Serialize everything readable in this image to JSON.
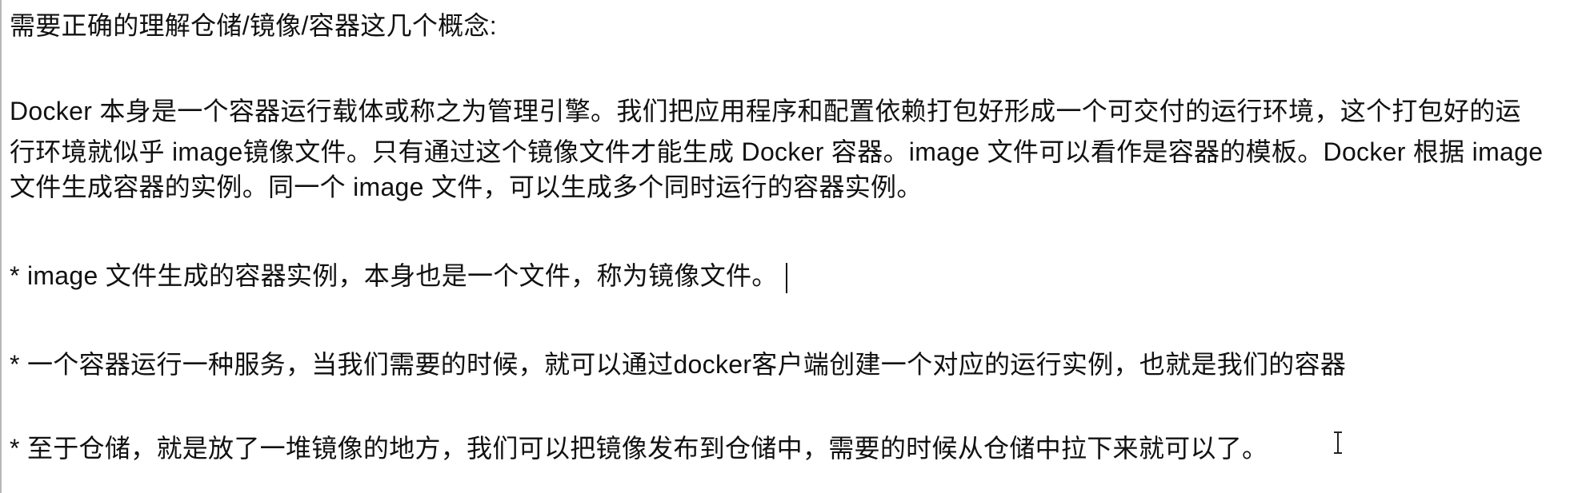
{
  "document": {
    "heading": "需要正确的理解仓储/镜像/容器这几个概念:",
    "paragraph_lines": [
      " Docker 本身是一个容器运行载体或称之为管理引擎。我们把应用程序和配置依赖打包好形成一个可交付的运行环境，这个打包好的运",
      "行环境就似乎 image镜像文件。只有通过这个镜像文件才能生成 Docker 容器。image 文件可以看作是容器的模板。Docker 根据 image",
      "文件生成容器的实例。同一个 image 文件，可以生成多个同时运行的容器实例。"
    ],
    "bullets": [
      "*  image 文件生成的容器实例，本身也是一个文件，称为镜像文件。",
      "*  一个容器运行一种服务，当我们需要的时候，就可以通过docker客户端创建一个对应的运行实例，也就是我们的容器",
      "* 至于仓储，就是放了一堆镜像的地方，我们可以把镜像发布到仓储中，需要的时候从仓储中拉下来就可以了。"
    ]
  }
}
